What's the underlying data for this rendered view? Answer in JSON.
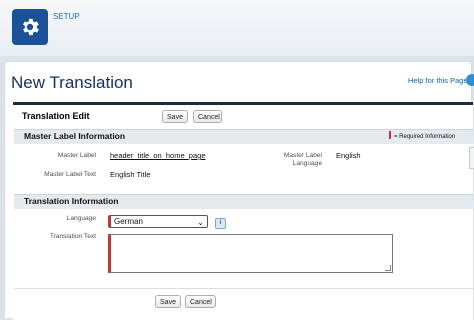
{
  "header": {
    "setup_label": "SETUP",
    "icon": "gear-icon"
  },
  "page": {
    "title": "New Translation",
    "help_link": "Help for this Page",
    "help_icon": "help-circle-icon"
  },
  "edit": {
    "title": "Translation Edit",
    "save_label": "Save",
    "cancel_label": "Cancel"
  },
  "master_section": {
    "title": "Master Label Information",
    "required_legend": "= Required Information",
    "master_label_label": "Master Label",
    "master_label_value": "header_title_on_home_page",
    "master_label_language_label": "Master Label Language",
    "master_label_language_value": "English",
    "master_label_text_label": "Master Label Text",
    "master_label_text_value": "English Title"
  },
  "translation_section": {
    "title": "Translation Information",
    "language_label": "Language",
    "language_value": "German",
    "translation_text_label": "Translation Text",
    "translation_text_value": "",
    "info_icon": "info-icon"
  },
  "footer": {
    "save_label": "Save",
    "cancel_label": "Cancel"
  },
  "colors": {
    "brand": "#1b5297",
    "required": "#c23934",
    "link": "#0b62b0"
  }
}
